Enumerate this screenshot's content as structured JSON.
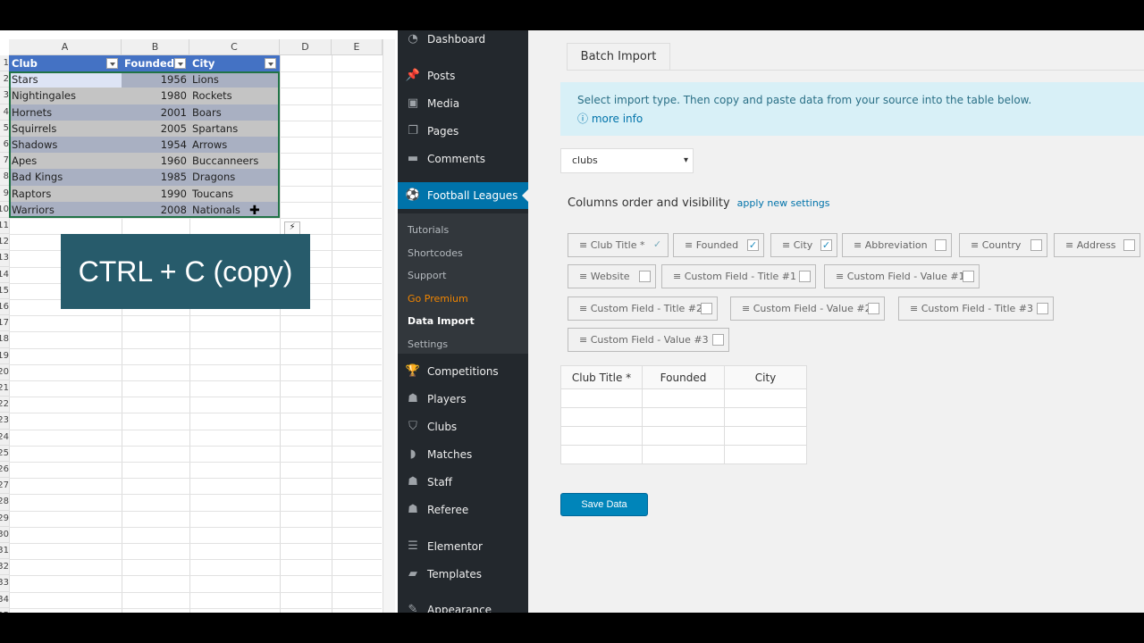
{
  "excel": {
    "columns": [
      "A",
      "B",
      "C",
      "D",
      "E"
    ],
    "headers": [
      "Club",
      "Founded",
      "City"
    ],
    "rows": [
      [
        "Stars",
        "1956",
        "Lions"
      ],
      [
        "Nightingales",
        "1980",
        "Rockets"
      ],
      [
        "Hornets",
        "2001",
        "Boars"
      ],
      [
        "Squirrels",
        "2005",
        "Spartans"
      ],
      [
        "Shadows",
        "1954",
        "Arrows"
      ],
      [
        "Apes",
        "1960",
        "Buccanneers"
      ],
      [
        "Bad Kings",
        "1985",
        "Dragons"
      ],
      [
        "Raptors",
        "1990",
        "Toucans"
      ],
      [
        "Warriors",
        "2008",
        "Nationals"
      ]
    ],
    "header_color": "#4472c4"
  },
  "overlay": {
    "text": "CTRL + C (copy)",
    "color": "#275b6b"
  },
  "sidebar": {
    "top": [
      {
        "label": "Dashboard",
        "icon": "dashboard-icon"
      },
      {
        "label": "Posts",
        "icon": "pin-icon"
      },
      {
        "label": "Media",
        "icon": "media-icon"
      },
      {
        "label": "Pages",
        "icon": "pages-icon"
      },
      {
        "label": "Comments",
        "icon": "comment-icon"
      }
    ],
    "active": {
      "label": "Football Leagues",
      "icon": "soccer-ball-icon"
    },
    "submenu": [
      {
        "label": "Tutorials"
      },
      {
        "label": "Shortcodes"
      },
      {
        "label": "Support"
      },
      {
        "label": "Go Premium",
        "color": "#f18500"
      },
      {
        "label": "Data Import",
        "current": true
      },
      {
        "label": "Settings"
      }
    ],
    "bottom": [
      {
        "label": "Competitions",
        "icon": "trophy-icon"
      },
      {
        "label": "Players",
        "icon": "group-icon"
      },
      {
        "label": "Clubs",
        "icon": "shield-icon"
      },
      {
        "label": "Matches",
        "icon": "matches-icon"
      },
      {
        "label": "Staff",
        "icon": "group-icon"
      },
      {
        "label": "Referee",
        "icon": "group-icon"
      },
      {
        "label": "Elementor",
        "icon": "elementor-icon"
      },
      {
        "label": "Templates",
        "icon": "folder-icon"
      },
      {
        "label": "Appearance",
        "icon": "brush-icon"
      }
    ],
    "accent": "#0073aa"
  },
  "main": {
    "tab": "Batch Import",
    "notice": "Select import type. Then copy and paste data from your source into the table below.",
    "more_info": "more info",
    "import_type": "clubs",
    "columns_title": "Columns order and visibility",
    "apply_link": "apply new settings",
    "chips": [
      {
        "label": "Club Title *",
        "checked": "required"
      },
      {
        "label": "Founded",
        "checked": true
      },
      {
        "label": "City",
        "checked": true
      },
      {
        "label": "Abbreviation",
        "checked": false
      },
      {
        "label": "Country",
        "checked": false
      },
      {
        "label": "Address",
        "checked": false
      },
      {
        "label": "Website",
        "checked": false
      },
      {
        "label": "Custom Field - Title #1",
        "checked": false
      },
      {
        "label": "Custom Field - Value #1",
        "checked": false
      },
      {
        "label": "Custom Field - Title #2",
        "checked": false
      },
      {
        "label": "Custom Field - Value #2",
        "checked": false
      },
      {
        "label": "Custom Field - Title #3",
        "checked": false
      },
      {
        "label": "Custom Field - Value #3",
        "checked": false
      }
    ],
    "table_headers": [
      "Club Title *",
      "Founded",
      "City"
    ],
    "save_label": "Save Data"
  }
}
